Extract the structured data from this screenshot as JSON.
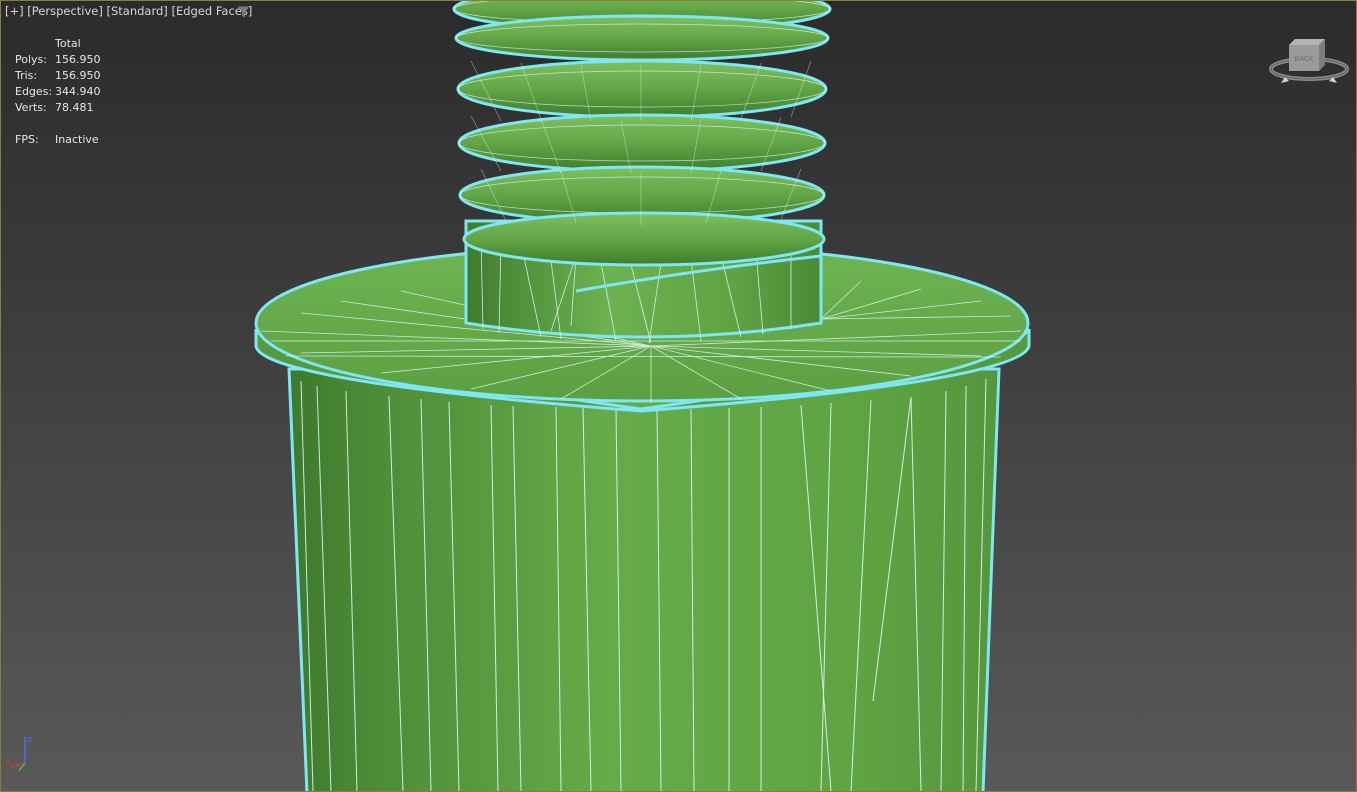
{
  "viewport": {
    "label_plus": "[+]",
    "label_view": "[Perspective]",
    "label_shading": "[Standard]",
    "label_display": "[Edged Faces]"
  },
  "stats": {
    "header": "Total",
    "rows": [
      {
        "key": "Polys:",
        "value": "156.950"
      },
      {
        "key": "Tris:",
        "value": "156.950"
      },
      {
        "key": "Edges:",
        "value": "344.940"
      },
      {
        "key": "Verts:",
        "value": "78.481"
      }
    ],
    "fps_key": "FPS:",
    "fps_value": "Inactive"
  },
  "viewcube": {
    "face": "BACK"
  },
  "axis": {
    "z": "z",
    "x": "x"
  },
  "colors": {
    "mesh": "#63a447",
    "wire": "#e9fbff",
    "selection": "#7fe6f2",
    "frame": "#8a7d38"
  }
}
